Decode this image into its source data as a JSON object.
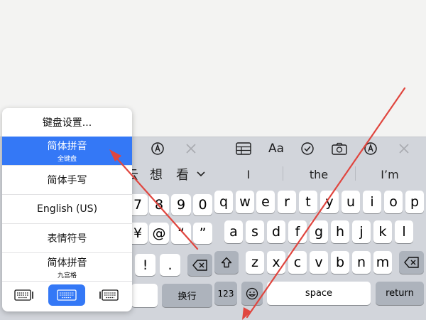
{
  "menu": {
    "items": [
      {
        "label": "键盘设置...",
        "sub": ""
      },
      {
        "label": "简体拼音",
        "sub": "全键盘",
        "selected": true
      },
      {
        "label": "简体手写",
        "sub": ""
      },
      {
        "label": "English (US)",
        "sub": ""
      },
      {
        "label": "表情符号",
        "sub": ""
      },
      {
        "label": "简体拼音",
        "sub": "九宫格"
      }
    ],
    "layout_options": [
      "keyboard-left-icon",
      "keyboard-full-icon",
      "keyboard-right-icon"
    ]
  },
  "left_keyboard": {
    "candidates": [
      "云",
      "想",
      "看"
    ],
    "row1": [
      "7",
      "8",
      "9",
      "0"
    ],
    "row2": [
      "¥",
      "@",
      "“",
      "”"
    ],
    "row3": [
      "!",
      "."
    ],
    "return_label": "换行"
  },
  "right_keyboard": {
    "suggestions": [
      "I",
      "the",
      "I’m"
    ],
    "row1": [
      "q",
      "w",
      "e",
      "r",
      "t",
      "y",
      "u",
      "i",
      "o",
      "p"
    ],
    "row2": [
      "a",
      "s",
      "d",
      "f",
      "g",
      "h",
      "j",
      "k",
      "l"
    ],
    "row3": [
      "z",
      "x",
      "c",
      "v",
      "b",
      "n",
      "m"
    ],
    "numbers_label": "123",
    "space_label": "space",
    "return_label": "return"
  },
  "colors": {
    "accent": "#3478f6",
    "arrow": "#e0463f",
    "keyboard_bg": "#d2d5db"
  }
}
